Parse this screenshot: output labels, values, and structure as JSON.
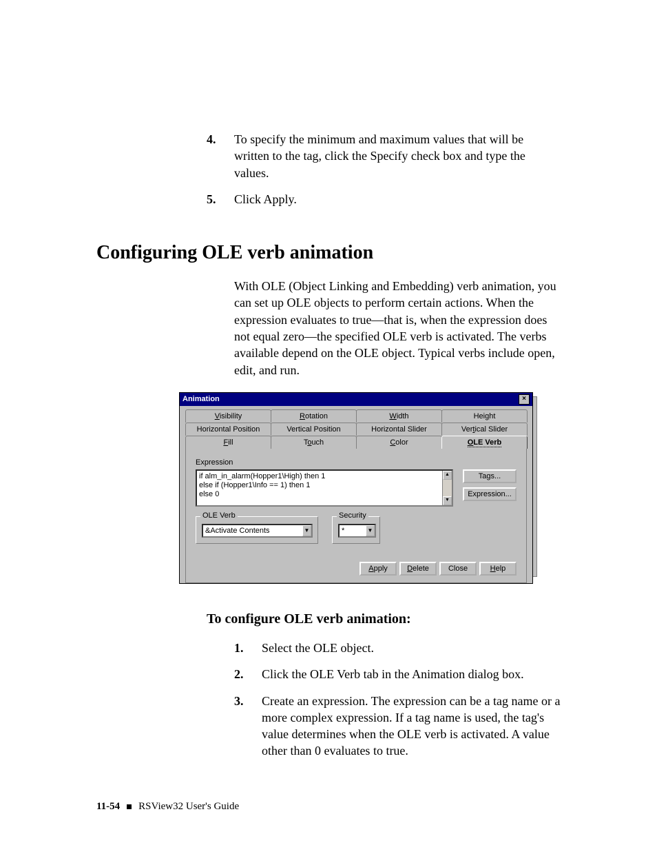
{
  "step4_num": "4.",
  "step4_text": "To specify the minimum and maximum values that will be written to the tag, click the Specify check box and type the values.",
  "step5_num": "5.",
  "step5_text": "Click Apply.",
  "section_heading": "Configuring OLE verb animation",
  "section_para": "With OLE (Object Linking and Embedding) verb animation, you can set up OLE objects to perform certain actions. When the expression evaluates to true—that is, when the expression does not equal zero—the specified OLE verb is activated. The verbs available depend on the OLE object. Typical verbs include open, edit, and run.",
  "dialog": {
    "title": "Animation",
    "tabs_row1": [
      {
        "pre": "",
        "ul": "V",
        "post": "isibility"
      },
      {
        "pre": "",
        "ul": "R",
        "post": "otation"
      },
      {
        "pre": "",
        "ul": "W",
        "post": "idth"
      },
      {
        "pre": "Hei",
        "ul": "g",
        "post": "ht"
      }
    ],
    "tabs_row2": [
      {
        "text": "Horizontal Position"
      },
      {
        "text": "Vertical Position"
      },
      {
        "text": "Horizontal Slider"
      },
      {
        "pre": "Ver",
        "ul": "t",
        "post": "ical Slider"
      }
    ],
    "tabs_row3": [
      {
        "pre": "",
        "ul": "F",
        "post": "ill"
      },
      {
        "pre": "T",
        "ul": "o",
        "post": "uch"
      },
      {
        "pre": "",
        "ul": "C",
        "post": "olor"
      },
      {
        "pre": "",
        "ul": "O",
        "post": "LE Verb",
        "active": true
      }
    ],
    "expression_label": "Expression",
    "expression_lines": [
      "if alm_in_alarm(Hopper1\\High) then 1",
      "else if (Hopper1\\Info == 1) then 1",
      "else 0"
    ],
    "tags_btn": "Tags...",
    "expr_btn": "Expression...",
    "ole_verb_legend": "OLE Verb",
    "ole_verb_value": "&Activate Contents",
    "security_legend": "Security",
    "security_value": "*",
    "apply": "Apply",
    "delete": "Delete",
    "close": "Close",
    "help": "Help"
  },
  "subsection_heading": "To configure OLE verb animation:",
  "b_step1_num": "1.",
  "b_step1_text": "Select the OLE object.",
  "b_step2_num": "2.",
  "b_step2_text": "Click the OLE Verb tab in the Animation dialog box.",
  "b_step3_num": "3.",
  "b_step3_text": "Create an expression. The expression can be a tag name or a more complex expression. If a tag name is used, the tag's value determines when the OLE verb is activated. A value other than 0 evaluates to true.",
  "footer_page": "11-54",
  "footer_text": "RSView32  User's Guide"
}
